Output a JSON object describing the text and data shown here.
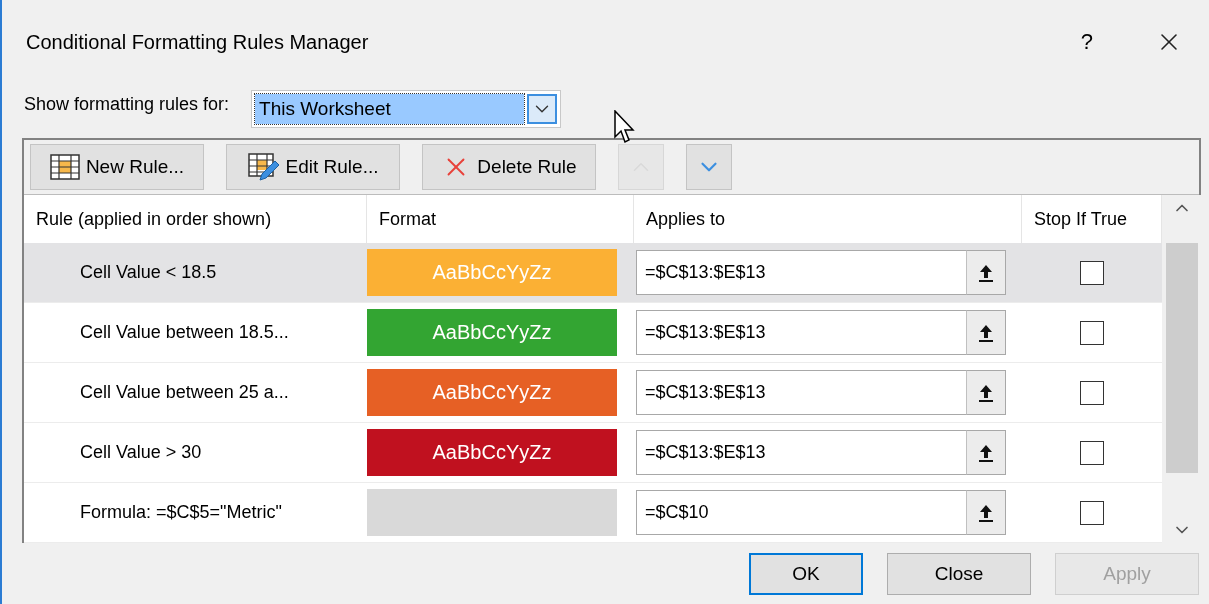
{
  "window": {
    "title": "Conditional Formatting Rules Manager",
    "help": "?"
  },
  "show_rules": {
    "label": "Show formatting rules for:",
    "value": "This Worksheet",
    "selected": true
  },
  "toolbar": [
    {
      "kind": "new",
      "label": "New Rule...",
      "disabled": false
    },
    {
      "kind": "edit",
      "label": "Edit Rule...",
      "disabled": false
    },
    {
      "kind": "delete",
      "label": "Delete Rule",
      "disabled": false
    },
    {
      "kind": "up",
      "disabled": true
    },
    {
      "kind": "down",
      "disabled": false
    }
  ],
  "columns": [
    "Rule (applied in order shown)",
    "Format",
    "Applies to",
    "Stop If True"
  ],
  "rows": [
    {
      "rule": "Cell Value < 18.5",
      "format": {
        "sample": "AaBbCcYyZz",
        "color": "#fbb034"
      },
      "applies_to": "=$C$13:$E$13",
      "stop_if_true": false,
      "selected": true
    },
    {
      "rule": "Cell Value between 18.5...",
      "format": {
        "sample": "AaBbCcYyZz",
        "color": "#33a532"
      },
      "applies_to": "=$C$13:$E$13",
      "stop_if_true": false,
      "selected": false
    },
    {
      "rule": "Cell Value between 25 a...",
      "format": {
        "sample": "AaBbCcYyZz",
        "color": "#e66025"
      },
      "applies_to": "=$C$13:$E$13",
      "stop_if_true": false,
      "selected": false
    },
    {
      "rule": "Cell Value > 30",
      "format": {
        "sample": "AaBbCcYyZz",
        "color": "#c0111f"
      },
      "applies_to": "=$C$13:$E$13",
      "stop_if_true": false,
      "selected": false
    },
    {
      "rule": "Formula: =$C$5=\"Metric\"",
      "format": {
        "color": "#d9d9d9"
      },
      "applies_to": "=$C$10",
      "stop_if_true": false,
      "selected": false
    }
  ],
  "buttons": [
    {
      "label": "OK",
      "default": true,
      "disabled": false
    },
    {
      "label": "Close",
      "default": false,
      "disabled": false
    },
    {
      "label": "Apply",
      "default": false,
      "disabled": true
    }
  ]
}
